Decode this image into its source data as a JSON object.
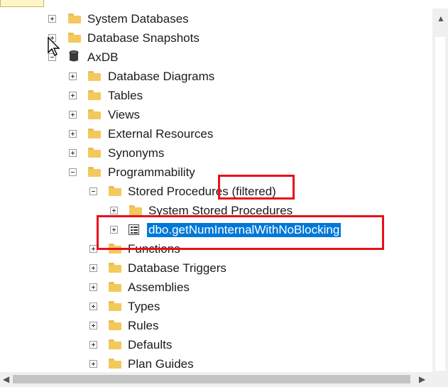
{
  "window": {
    "partial_title": ""
  },
  "tree": {
    "nodes": [
      {
        "label": "System Databases",
        "icon": "folder-icon",
        "expander": "plus"
      },
      {
        "label": "Database Snapshots",
        "icon": "folder-icon",
        "expander": "plus"
      },
      {
        "label": "AxDB",
        "icon": "database-icon",
        "expander": "minus"
      },
      {
        "label": "Database Diagrams",
        "icon": "folder-icon",
        "expander": "plus"
      },
      {
        "label": "Tables",
        "icon": "folder-icon",
        "expander": "plus"
      },
      {
        "label": "Views",
        "icon": "folder-icon",
        "expander": "plus"
      },
      {
        "label": "External Resources",
        "icon": "folder-icon",
        "expander": "plus"
      },
      {
        "label": "Synonyms",
        "icon": "folder-icon",
        "expander": "plus"
      },
      {
        "label": "Programmability",
        "icon": "folder-icon",
        "expander": "minus"
      },
      {
        "label": "Stored Procedures (filtered)",
        "icon": "folder-icon",
        "expander": "minus"
      },
      {
        "label": "System Stored Procedures",
        "icon": "folder-icon",
        "expander": "plus"
      },
      {
        "label": "dbo.getNumInternalWithNoBlocking",
        "icon": "stored-procedure-icon",
        "expander": "plus",
        "selected": true
      },
      {
        "label": "Functions",
        "icon": "folder-icon",
        "expander": "plus"
      },
      {
        "label": "Database Triggers",
        "icon": "folder-icon",
        "expander": "plus"
      },
      {
        "label": "Assemblies",
        "icon": "folder-icon",
        "expander": "plus"
      },
      {
        "label": "Types",
        "icon": "folder-icon",
        "expander": "plus"
      },
      {
        "label": "Rules",
        "icon": "folder-icon",
        "expander": "plus"
      },
      {
        "label": "Defaults",
        "icon": "folder-icon",
        "expander": "plus"
      },
      {
        "label": "Plan Guides",
        "icon": "folder-icon",
        "expander": "plus"
      }
    ]
  },
  "colors": {
    "selection": "#0078d7",
    "highlight_box": "#e8101a",
    "folder": "#f3c85d"
  }
}
